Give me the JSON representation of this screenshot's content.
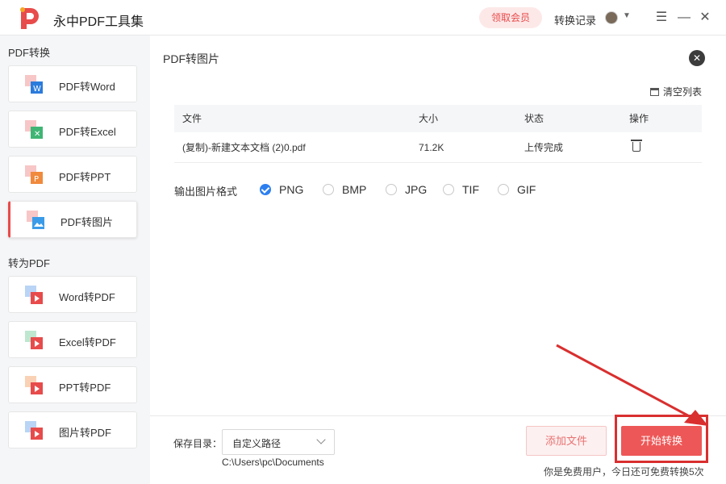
{
  "app": {
    "title": "永中PDF工具集"
  },
  "header": {
    "vip_label": "领取会员",
    "history_label": "转换记录"
  },
  "colors": {
    "accent": "#e84b4b",
    "checked_radio": "#2d7ff0",
    "start_button": "#ee5757"
  },
  "sidebar": {
    "section_from": "PDF转换",
    "section_to": "转为PDF",
    "from_items": [
      {
        "label": "PDF转Word",
        "icon": "pdf-to-word-icon"
      },
      {
        "label": "PDF转Excel",
        "icon": "pdf-to-excel-icon"
      },
      {
        "label": "PDF转PPT",
        "icon": "pdf-to-ppt-icon"
      },
      {
        "label": "PDF转图片",
        "icon": "pdf-to-image-icon",
        "active": true
      }
    ],
    "to_items": [
      {
        "label": "Word转PDF",
        "icon": "word-to-pdf-icon"
      },
      {
        "label": "Excel转PDF",
        "icon": "excel-to-pdf-icon"
      },
      {
        "label": "PPT转PDF",
        "icon": "ppt-to-pdf-icon"
      },
      {
        "label": "图片转PDF",
        "icon": "image-to-pdf-icon"
      }
    ]
  },
  "main": {
    "title": "PDF转图片",
    "clear_list": "清空列表",
    "table": {
      "headers": [
        "文件",
        "大小",
        "状态",
        "操作"
      ],
      "rows": [
        {
          "file": "(复制)-新建文本文档 (2)0.pdf",
          "size": "71.2K",
          "status": "上传完成"
        }
      ]
    },
    "format_label": "输出图片格式",
    "formats": [
      {
        "label": "PNG",
        "checked": true
      },
      {
        "label": "BMP",
        "checked": false
      },
      {
        "label": "JPG",
        "checked": false
      },
      {
        "label": "TIF",
        "checked": false
      },
      {
        "label": "GIF",
        "checked": false
      }
    ],
    "save": {
      "label": "保存目录：",
      "selected": "自定义路径",
      "path": "C:\\Users\\pc\\Documents"
    },
    "add_file_label": "添加文件",
    "start_label": "开始转换",
    "quota_text": "你是免费用户，今日还可免费转换5次"
  }
}
